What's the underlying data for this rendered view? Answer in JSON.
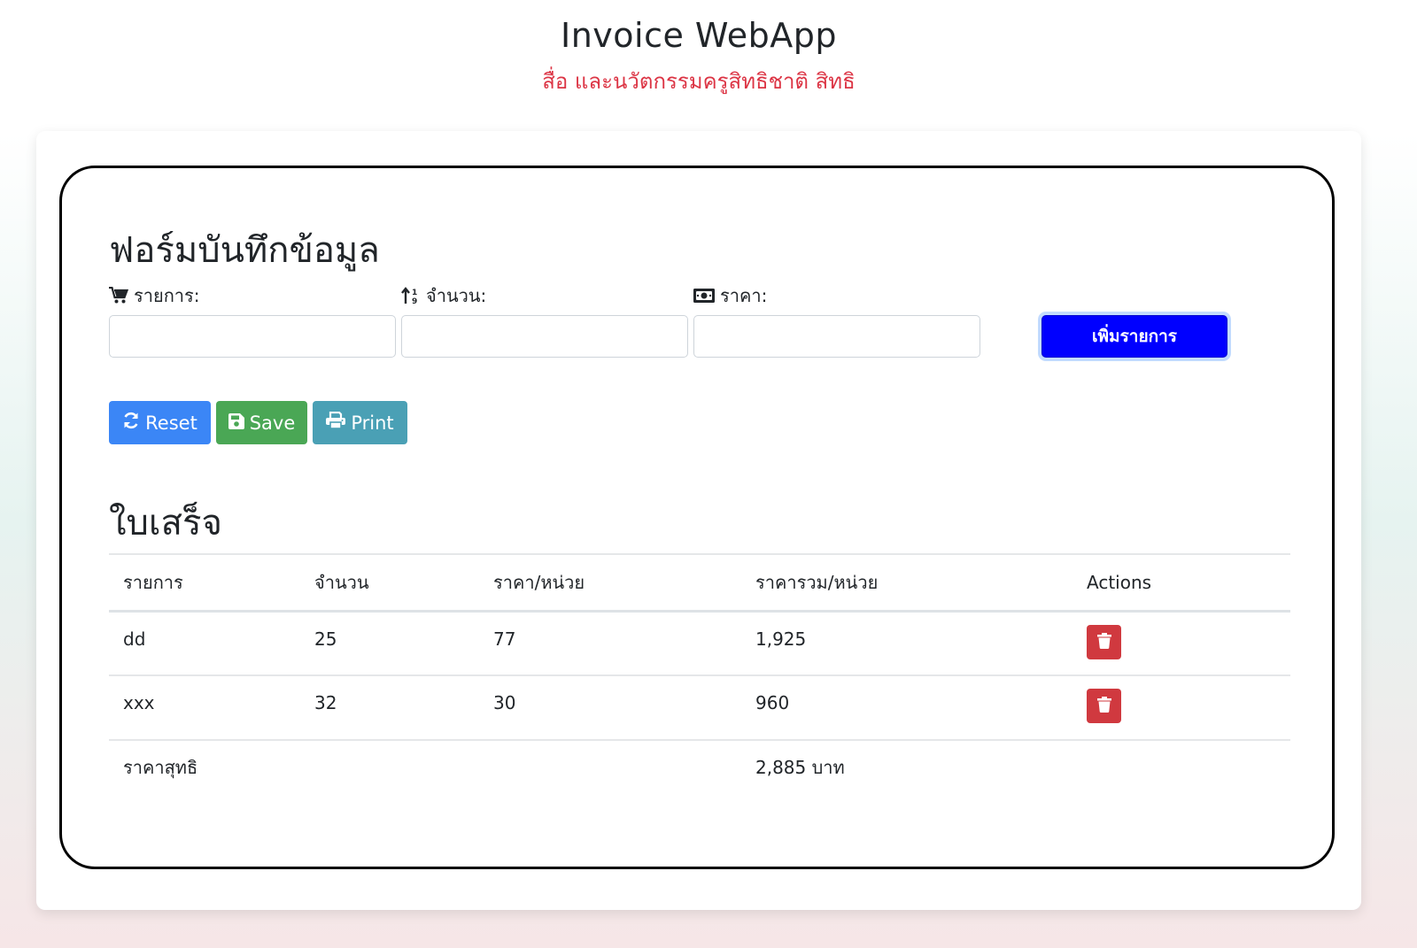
{
  "header": {
    "title": "Invoice WebApp",
    "subtitle": "สื่อ และนวัตกรรมครูสิทธิชาติ สิทธิ"
  },
  "form": {
    "title": "ฟอร์มบันทึกข้อมูล",
    "item_label": "รายการ:",
    "qty_label": "จำนวน:",
    "price_label": "ราคา:",
    "item_value": "",
    "qty_value": "",
    "price_value": "",
    "add_button": "เพิ่มรายการ",
    "icons": {
      "item": "shopping-cart-icon",
      "qty": "sort-numeric-icon",
      "price": "money-bill-icon"
    }
  },
  "actions": {
    "reset": "Reset",
    "save": "Save",
    "print": "Print",
    "icons": {
      "reset": "refresh-icon",
      "save": "floppy-disk-icon",
      "print": "printer-icon"
    }
  },
  "receipt": {
    "title": "ใบเสร็จ",
    "columns": [
      "รายการ",
      "จำนวน",
      "ราคา/หน่วย",
      "ราคารวม/หน่วย",
      "Actions"
    ],
    "rows": [
      {
        "item": "dd",
        "qty": "25",
        "unit_price": "77",
        "total": "1,925"
      },
      {
        "item": "xxx",
        "qty": "32",
        "unit_price": "30",
        "total": "960"
      }
    ],
    "total_label": "ราคาสุทธิ",
    "total_value": "2,885 บาท",
    "delete_icon": "trash-icon"
  },
  "colors": {
    "subtitle": "#dc3545",
    "add_button": "#0000ff",
    "reset_button": "#3b86f6",
    "save_button": "#4aa755",
    "print_button": "#4aa0b5",
    "delete_button": "#d0393f"
  }
}
